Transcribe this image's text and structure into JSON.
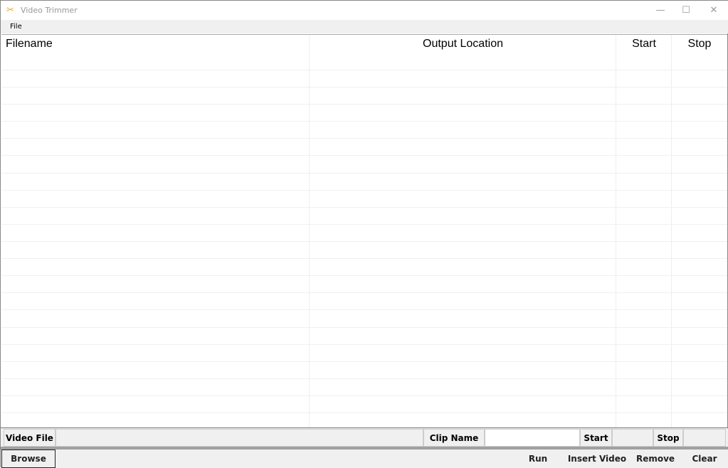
{
  "window": {
    "title": "Video Trimmer",
    "icon": "scissors-icon"
  },
  "menu": {
    "file": "File"
  },
  "table": {
    "columns": [
      "Filename",
      "Output Location",
      "Start",
      "Stop"
    ],
    "rows": []
  },
  "form": {
    "video_file_label": "Video File",
    "video_file_value": "",
    "clip_name_label": "Clip Name",
    "clip_name_value": "",
    "start_label": "Start",
    "start_value": "",
    "stop_label": "Stop",
    "stop_value": ""
  },
  "buttons": {
    "browse": "Browse",
    "run": "Run",
    "insert_video": "Insert Video",
    "remove": "Remove",
    "clear": "Clear"
  }
}
